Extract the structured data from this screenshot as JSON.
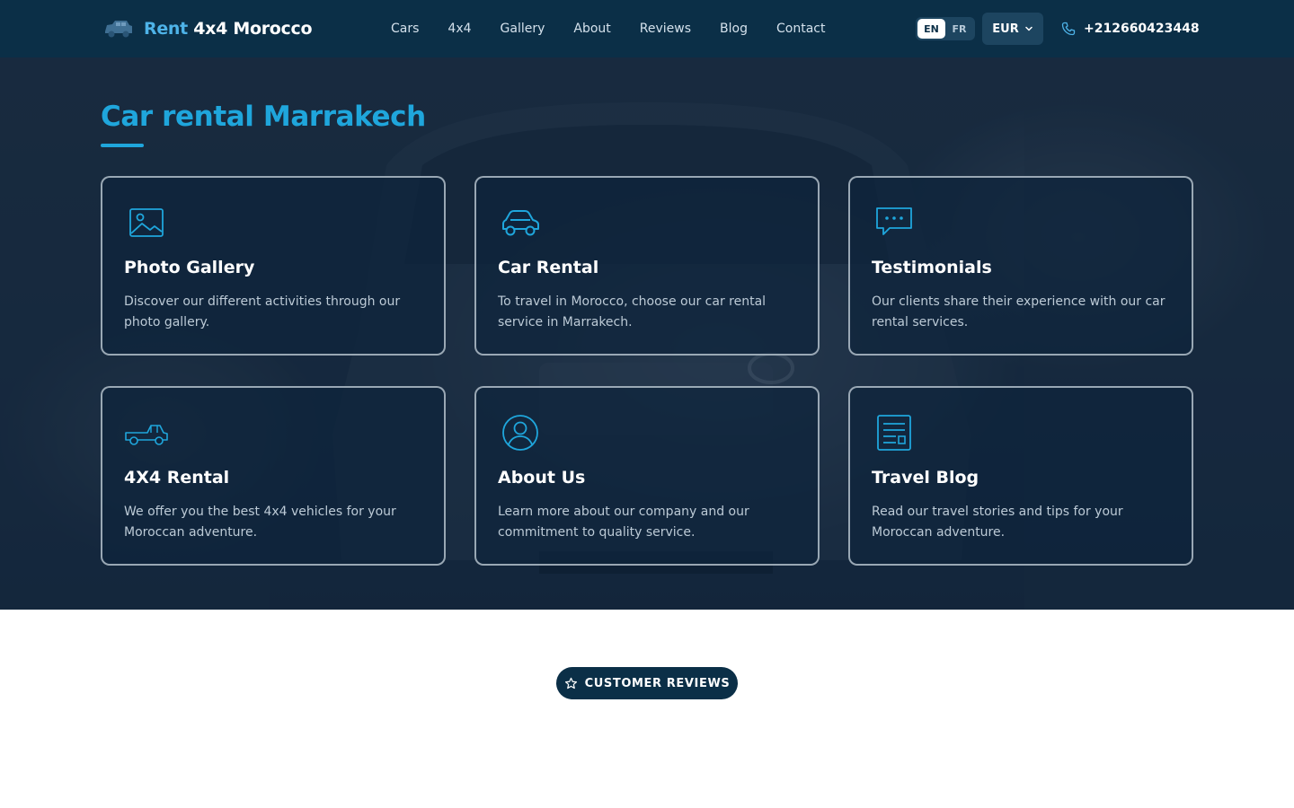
{
  "brand": {
    "name_part1": "Rent",
    "name_part2": "4x4 Morocco"
  },
  "nav": {
    "items": [
      {
        "label": "Cars"
      },
      {
        "label": "4x4"
      },
      {
        "label": "Gallery"
      },
      {
        "label": "About"
      },
      {
        "label": "Reviews"
      },
      {
        "label": "Blog"
      },
      {
        "label": "Contact"
      }
    ]
  },
  "language": {
    "options": [
      "EN",
      "FR"
    ],
    "selected": "EN"
  },
  "currency": {
    "selected": "EUR"
  },
  "contact": {
    "phone": "+212660423448"
  },
  "hero": {
    "title": "Car rental Marrakech",
    "cards": [
      {
        "title": "Photo Gallery",
        "description": "Discover our different activities through our photo gallery.",
        "icon": "image-icon"
      },
      {
        "title": "Car Rental",
        "description": "To travel in Morocco, choose our car rental service in Marrakech.",
        "icon": "car-icon"
      },
      {
        "title": "Testimonials",
        "description": "Our clients share their experience with our car rental services.",
        "icon": "chat-bubble-icon"
      },
      {
        "title": "4X4 Rental",
        "description": "We offer you the best 4x4 vehicles for your Moroccan adventure.",
        "icon": "pickup-truck-icon"
      },
      {
        "title": "About Us",
        "description": "Learn more about our company and our commitment to quality service.",
        "icon": "user-circle-icon"
      },
      {
        "title": "Travel Blog",
        "description": "Read our travel stories and tips for your Moroccan adventure.",
        "icon": "document-icon"
      }
    ]
  },
  "reviews": {
    "badge_label": "CUSTOMER REVIEWS"
  },
  "colors": {
    "header_bg": "#0b2f47",
    "accent": "#1fa6dc",
    "brand_light": "#4eb3e8"
  }
}
